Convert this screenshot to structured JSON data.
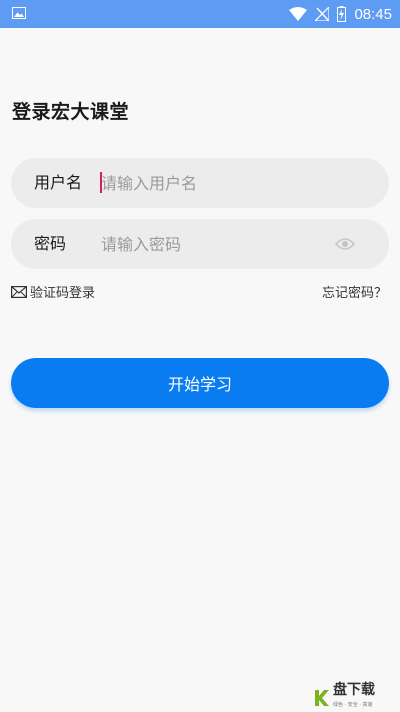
{
  "status_bar": {
    "time": "08:45",
    "color": "#5e9bf2"
  },
  "page": {
    "title": "登录宏大课堂"
  },
  "username_field": {
    "label": "用户名",
    "placeholder": "请输入用户名",
    "value": ""
  },
  "password_field": {
    "label": "密码",
    "placeholder": "请输入密码",
    "value": "",
    "toggle_icon": "eye-icon"
  },
  "links": {
    "sms_login": "验证码登录",
    "forgot_password": "忘记密码？"
  },
  "submit": {
    "label": "开始学习",
    "color": "#0a7cf2"
  },
  "watermark": {
    "brand": "快盘下载",
    "brand_main": "盘下载",
    "brand_sub": "绿色 · 安全 · 高速"
  }
}
